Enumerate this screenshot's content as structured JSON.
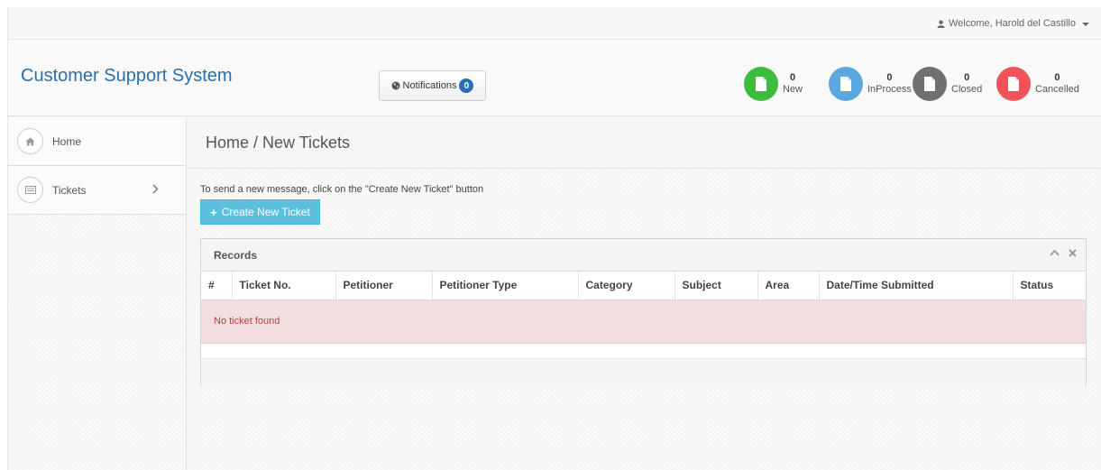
{
  "topbar": {
    "welcome": "Welcome, Harold del Castillo"
  },
  "header": {
    "brand": "Customer Support System",
    "notifications": {
      "label": "Notifications",
      "count": "0"
    },
    "stats": [
      {
        "count": "0",
        "label": "New",
        "color": "#3dbb3d"
      },
      {
        "count": "0",
        "label": "InProcess",
        "color": "#5aa8de"
      },
      {
        "count": "0",
        "label": "Closed",
        "color": "#707070"
      },
      {
        "count": "0",
        "label": "Cancelled",
        "color": "#f0535a"
      }
    ]
  },
  "sidebar": {
    "items": [
      {
        "label": "Home",
        "icon": "home-icon"
      },
      {
        "label": "Tickets",
        "icon": "list-icon"
      }
    ]
  },
  "main": {
    "breadcrumb": "Home / New Tickets",
    "hint": "To send a new message, click on the \"Create New Ticket\" button",
    "create_button": "Create New Ticket",
    "panel": {
      "title": "Records",
      "columns": [
        "#",
        "Ticket No.",
        "Petitioner",
        "Petitioner Type",
        "Category",
        "Subject",
        "Area",
        "Date/Time Submitted",
        "Status"
      ],
      "empty_message": "No ticket found"
    }
  },
  "colors": {
    "brand": "#2c6fa4",
    "primary_button": "#5bc0de",
    "badge": "#2d6db5"
  }
}
